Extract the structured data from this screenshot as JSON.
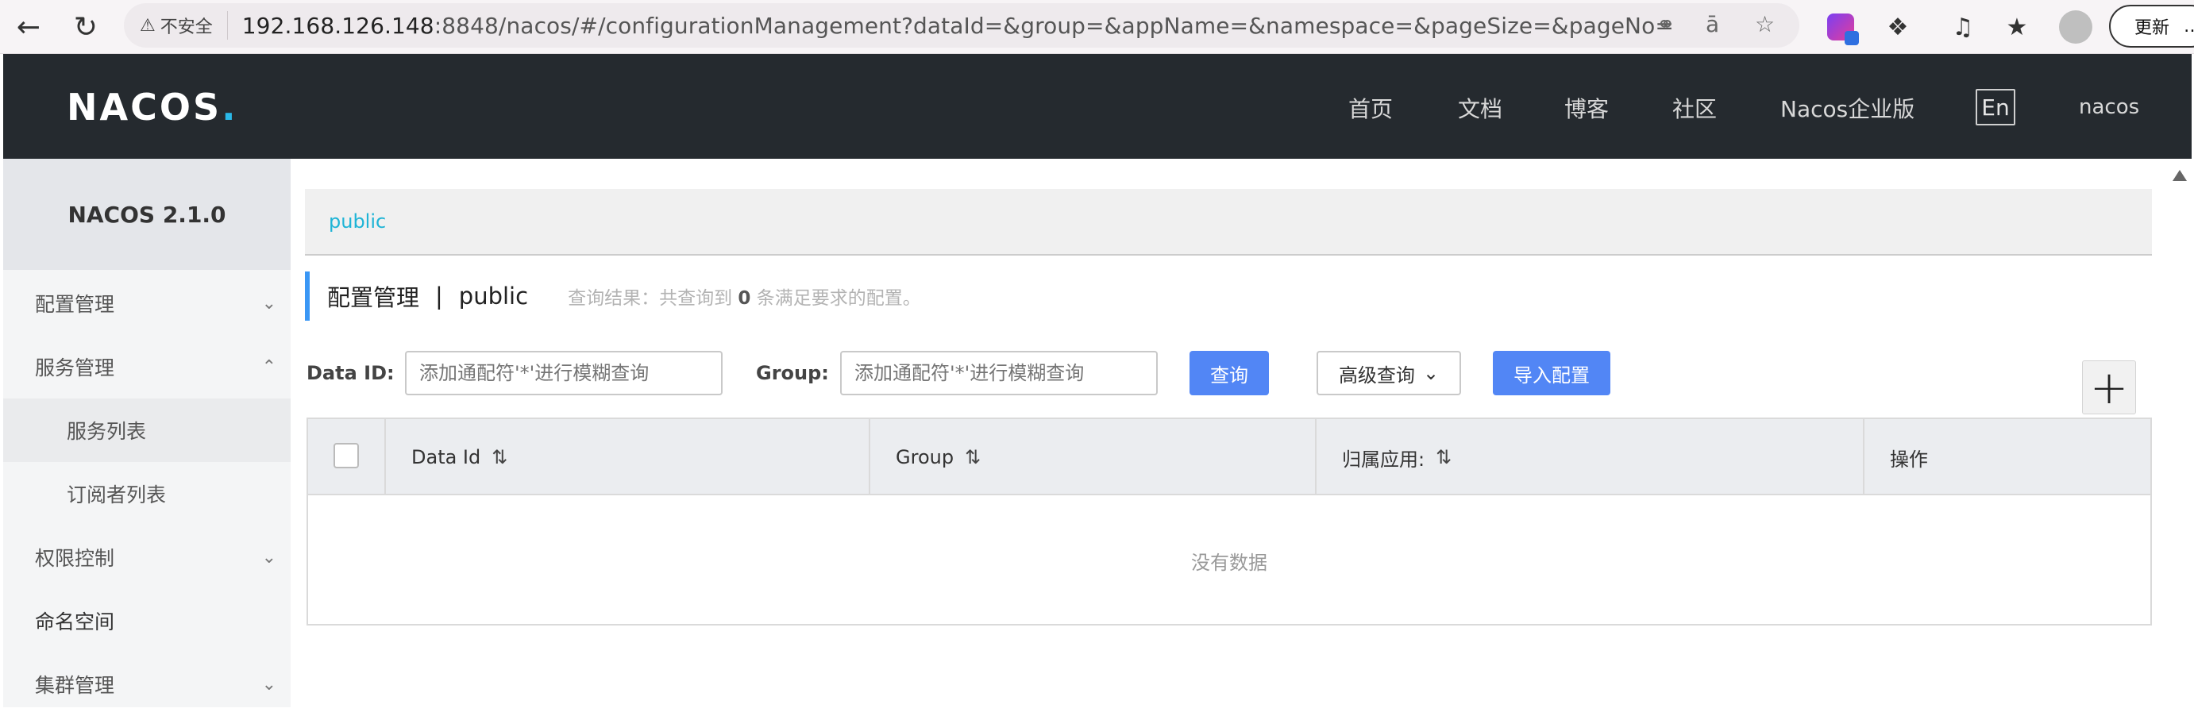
{
  "browser": {
    "security_label": "不安全",
    "url_host": "192.168.126.148",
    "url_rest": ":8848/nacos/#/configurationManagement?dataId=&group=&appName=&namespace=&pageSize=&pageNo=",
    "update_label": "更新",
    "update_more": "…"
  },
  "header": {
    "logo_main": "NACOS",
    "logo_dot": ".",
    "nav": [
      "首页",
      "文档",
      "博客",
      "社区",
      "Nacos企业版"
    ],
    "lang_button": "En",
    "user": "nacos"
  },
  "sidebar": {
    "version": "NACOS 2.1.0",
    "items": [
      {
        "label": "配置管理"
      },
      {
        "label": "服务管理"
      },
      {
        "label": "服务列表"
      },
      {
        "label": "订阅者列表"
      },
      {
        "label": "权限控制"
      },
      {
        "label": "命名空间"
      },
      {
        "label": "集群管理"
      }
    ]
  },
  "main": {
    "namespace_tab": "public",
    "title": "配置管理",
    "title_sep": "|",
    "title_namespace": "public",
    "result_prefix": "查询结果：共查询到",
    "result_count": "0",
    "result_suffix": "条满足要求的配置。",
    "search": {
      "dataid_label": "Data ID:",
      "dataid_placeholder": "添加通配符'*'进行模糊查询",
      "group_label": "Group:",
      "group_placeholder": "添加通配符'*'进行模糊查询",
      "query_button": "查询",
      "advanced_button": "高级查询",
      "import_button": "导入配置"
    },
    "add_button": "+",
    "table": {
      "columns": [
        "Data Id",
        "Group",
        "归属应用:",
        "操作"
      ],
      "empty_text": "没有数据"
    }
  }
}
